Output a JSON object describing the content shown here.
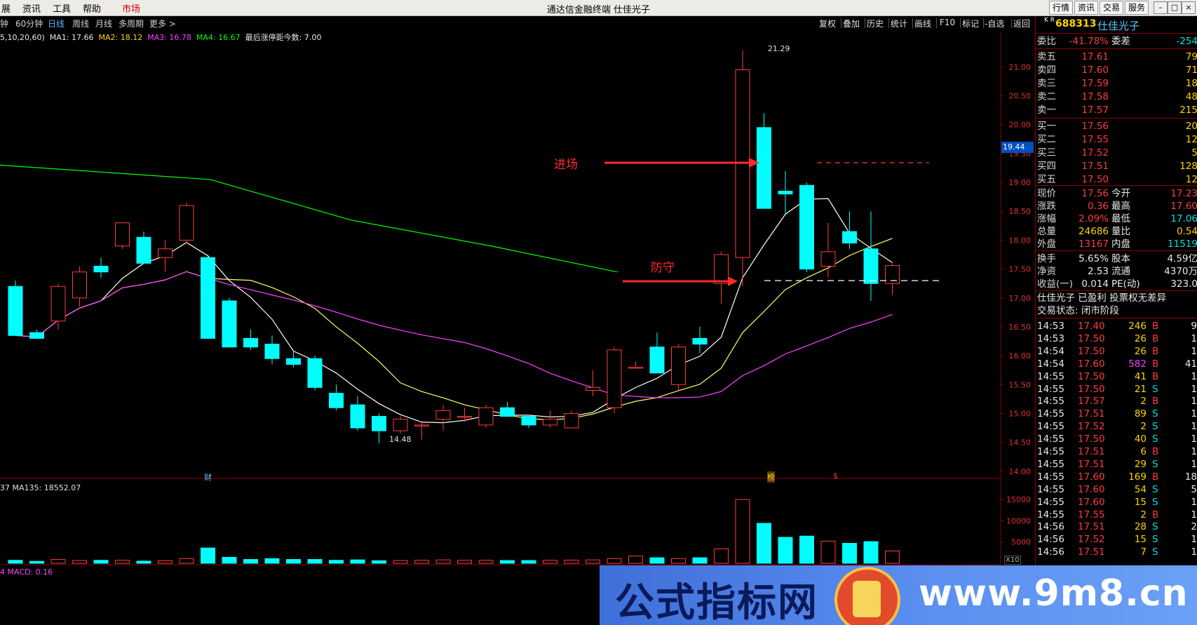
{
  "menu": {
    "items": [
      "展",
      "资讯",
      "工具",
      "帮助"
    ],
    "active": "市场"
  },
  "app_title": "通达信金融终端  仕佳光子",
  "top_right_buttons": [
    "行情",
    "资讯",
    "交易",
    "服务"
  ],
  "periods": [
    "钟",
    "60分钟",
    "日线",
    "周线",
    "月线",
    "多周期",
    "更多 >"
  ],
  "active_period": "日线",
  "toolbar": [
    "复权",
    "叠加",
    "历史",
    "统计",
    "画线",
    "F10",
    "标记",
    "-自选",
    "返回"
  ],
  "ma_line": {
    "prefix": "5,10,20,60)",
    "ma1": "MA1: 17.66",
    "ma2": "MA2: 18.12",
    "ma3": "MA3: 16.78",
    "ma4": "MA4: 16.67",
    "note": "最后涨停距今数: 7.00"
  },
  "y_axis_ticks": [
    "21.00",
    "20.50",
    "20.00",
    "19.50",
    "19.00",
    "18.50",
    "18.00",
    "17.50",
    "17.00",
    "16.50",
    "16.00",
    "15.50",
    "15.00",
    "14.50",
    "14.00"
  ],
  "cursor_price": "19.44",
  "high_label": "21.29",
  "low_label": "14.48",
  "annotations": {
    "entry": "进场",
    "defend": "防守"
  },
  "markers": {
    "cai": "财",
    "bang": "榜",
    "s": "$"
  },
  "volume_header": "37  MA135: 18552.07",
  "volume_ticks": [
    "15000",
    "10000",
    "5000"
  ],
  "volume_unit": "X10",
  "macd_header": "4  MACD: 0.16",
  "colors": {
    "up": "#ff3b3b",
    "down": "#00ffff",
    "ma1": "#ffffff",
    "ma2": "#ffff66",
    "ma3": "#ff44ff",
    "ma4": "#00ff00",
    "axis": "#8a0000"
  },
  "chart_data": {
    "type": "candlestick",
    "symbol": "688313",
    "name": "仕佳光子",
    "candles": [
      {
        "o": 17.2,
        "h": 17.3,
        "l": 16.35,
        "c": 16.35
      },
      {
        "o": 16.4,
        "h": 16.45,
        "l": 16.3,
        "c": 16.3
      },
      {
        "o": 16.6,
        "h": 17.25,
        "l": 16.45,
        "c": 17.2
      },
      {
        "o": 17.0,
        "h": 17.55,
        "l": 16.85,
        "c": 17.45
      },
      {
        "o": 17.55,
        "h": 17.7,
        "l": 17.35,
        "c": 17.45
      },
      {
        "o": 17.9,
        "h": 18.3,
        "l": 17.85,
        "c": 18.3
      },
      {
        "o": 18.05,
        "h": 18.15,
        "l": 17.6,
        "c": 17.6
      },
      {
        "o": 17.7,
        "h": 18.0,
        "l": 17.45,
        "c": 17.85
      },
      {
        "o": 18.0,
        "h": 18.65,
        "l": 17.95,
        "c": 18.6
      },
      {
        "o": 17.7,
        "h": 17.75,
        "l": 16.3,
        "c": 16.3
      },
      {
        "o": 16.95,
        "h": 17.0,
        "l": 16.15,
        "c": 16.15
      },
      {
        "o": 16.3,
        "h": 16.45,
        "l": 16.1,
        "c": 16.15
      },
      {
        "o": 16.2,
        "h": 16.35,
        "l": 15.85,
        "c": 15.95
      },
      {
        "o": 15.95,
        "h": 16.1,
        "l": 15.8,
        "c": 15.85
      },
      {
        "o": 15.95,
        "h": 16.0,
        "l": 15.4,
        "c": 15.45
      },
      {
        "o": 15.35,
        "h": 15.5,
        "l": 15.05,
        "c": 15.1
      },
      {
        "o": 15.15,
        "h": 15.3,
        "l": 14.7,
        "c": 14.75
      },
      {
        "o": 14.95,
        "h": 15.0,
        "l": 14.48,
        "c": 14.7
      },
      {
        "o": 14.7,
        "h": 14.95,
        "l": 14.65,
        "c": 14.9
      },
      {
        "o": 14.8,
        "h": 14.85,
        "l": 14.55,
        "c": 14.8
      },
      {
        "o": 14.9,
        "h": 15.15,
        "l": 14.7,
        "c": 15.05
      },
      {
        "o": 14.95,
        "h": 15.1,
        "l": 14.85,
        "c": 14.95
      },
      {
        "o": 14.8,
        "h": 15.15,
        "l": 14.75,
        "c": 15.1
      },
      {
        "o": 15.1,
        "h": 15.2,
        "l": 14.95,
        "c": 14.95
      },
      {
        "o": 14.95,
        "h": 14.95,
        "l": 14.75,
        "c": 14.8
      },
      {
        "o": 14.8,
        "h": 15.05,
        "l": 14.75,
        "c": 14.9
      },
      {
        "o": 14.75,
        "h": 15.05,
        "l": 14.75,
        "c": 15.0
      },
      {
        "o": 15.4,
        "h": 15.75,
        "l": 15.3,
        "c": 15.45
      },
      {
        "o": 15.1,
        "h": 16.15,
        "l": 15.0,
        "c": 16.1
      },
      {
        "o": 15.8,
        "h": 15.9,
        "l": 15.8,
        "c": 15.8
      },
      {
        "o": 16.15,
        "h": 16.4,
        "l": 15.7,
        "c": 15.7
      },
      {
        "o": 15.5,
        "h": 16.2,
        "l": 15.4,
        "c": 16.15
      },
      {
        "o": 16.3,
        "h": 16.5,
        "l": 16.05,
        "c": 16.2
      },
      {
        "o": 17.25,
        "h": 17.8,
        "l": 16.9,
        "c": 17.75
      },
      {
        "o": 17.7,
        "h": 21.29,
        "l": 17.2,
        "c": 20.95
      },
      {
        "o": 19.95,
        "h": 20.2,
        "l": 18.55,
        "c": 18.55
      },
      {
        "o": 18.85,
        "h": 19.2,
        "l": 18.45,
        "c": 18.8
      },
      {
        "o": 18.95,
        "h": 19.0,
        "l": 17.45,
        "c": 17.5
      },
      {
        "o": 17.55,
        "h": 18.3,
        "l": 17.35,
        "c": 17.8
      },
      {
        "o": 18.15,
        "h": 18.5,
        "l": 17.85,
        "c": 17.95
      },
      {
        "o": 17.85,
        "h": 18.5,
        "l": 16.95,
        "c": 17.25
      },
      {
        "o": 17.25,
        "h": 17.6,
        "l": 17.05,
        "c": 17.56
      }
    ],
    "ma_lines": {
      "MA1": 17.66,
      "MA2": 18.12,
      "MA3": 16.78,
      "MA4": 16.67
    },
    "volume": [
      700,
      450,
      900,
      650,
      700,
      700,
      500,
      600,
      1100,
      3600,
      1400,
      900,
      1100,
      900,
      900,
      700,
      800,
      600,
      650,
      700,
      800,
      700,
      700,
      650,
      650,
      700,
      750,
      800,
      1100,
      1700,
      1300,
      1100,
      1300,
      3400,
      15000,
      9400,
      6100,
      6400,
      5200,
      4700,
      5100,
      2900
    ],
    "ylim": [
      13.9,
      21.6
    ],
    "volume_ylim": [
      0,
      17000
    ]
  },
  "quote_panel": {
    "badge": "K R",
    "code": "688313",
    "name": "仕佳光子",
    "webi": {
      "label": "委比",
      "value": "-41.78%",
      "label2": "委差",
      "value2": "-254"
    },
    "asks": [
      {
        "label": "卖五",
        "price": "17.61",
        "vol": "79"
      },
      {
        "label": "卖四",
        "price": "17.60",
        "vol": "71"
      },
      {
        "label": "卖三",
        "price": "17.59",
        "vol": "18"
      },
      {
        "label": "卖二",
        "price": "17.58",
        "vol": "48"
      },
      {
        "label": "卖一",
        "price": "17.57",
        "vol": "215"
      }
    ],
    "bids": [
      {
        "label": "买一",
        "price": "17.56",
        "vol": "20"
      },
      {
        "label": "买二",
        "price": "17.55",
        "vol": "12"
      },
      {
        "label": "买三",
        "price": "17.52",
        "vol": "5"
      },
      {
        "label": "买四",
        "price": "17.51",
        "vol": "128"
      },
      {
        "label": "买五",
        "price": "17.50",
        "vol": "12"
      }
    ],
    "stats1": [
      {
        "l1": "现价",
        "v1": "17.56",
        "c1": "r",
        "l2": "今开",
        "v2": "17.23",
        "c2": "r"
      },
      {
        "l1": "涨跌",
        "v1": "0.36",
        "c1": "r",
        "l2": "最高",
        "v2": "17.60",
        "c2": "r"
      },
      {
        "l1": "涨幅",
        "v1": "2.09%",
        "c1": "r",
        "l2": "最低",
        "v2": "17.06",
        "c2": "g"
      },
      {
        "l1": "总量",
        "v1": "24686",
        "c1": "y",
        "l2": "量比",
        "v2": "0.54",
        "c2": "y"
      },
      {
        "l1": "外盘",
        "v1": "13167",
        "c1": "r",
        "l2": "内盘",
        "v2": "11519",
        "c2": "g"
      }
    ],
    "stats2": [
      {
        "l1": "换手",
        "v1": "5.65%",
        "l2": "股本",
        "v2": "4.59亿"
      },
      {
        "l1": "净资",
        "v1": "2.53",
        "l2": "流通",
        "v2": "4370万"
      },
      {
        "l1": "收益(一)",
        "v1": "0.014",
        "l2": "PE(动)",
        "v2": "323.0"
      }
    ],
    "info1": "仕佳光子 已盈利 投票权无差异",
    "info2": "交易状态: 闭市阶段",
    "ticks": [
      {
        "t": "14:53",
        "p": "17.40",
        "pc": "r",
        "v": "246",
        "vc": "y",
        "s": "B",
        "sc": "r",
        "n": "9"
      },
      {
        "t": "14:53",
        "p": "17.50",
        "pc": "r",
        "v": "26",
        "vc": "y",
        "s": "B",
        "sc": "r",
        "n": "1"
      },
      {
        "t": "14:54",
        "p": "17.50",
        "pc": "r",
        "v": "26",
        "vc": "y",
        "s": "B",
        "sc": "r",
        "n": "1"
      },
      {
        "t": "14:54",
        "p": "17.60",
        "pc": "r",
        "v": "582",
        "vc": "m",
        "s": "B",
        "sc": "r",
        "n": "41"
      },
      {
        "t": "14:55",
        "p": "17.50",
        "pc": "r",
        "v": "41",
        "vc": "y",
        "s": "B",
        "sc": "r",
        "n": "1"
      },
      {
        "t": "14:55",
        "p": "17.50",
        "pc": "r",
        "v": "21",
        "vc": "y",
        "s": "S",
        "sc": "g",
        "n": "1"
      },
      {
        "t": "14:55",
        "p": "17.57",
        "pc": "r",
        "v": "2",
        "vc": "y",
        "s": "B",
        "sc": "r",
        "n": "1"
      },
      {
        "t": "14:55",
        "p": "17.51",
        "pc": "r",
        "v": "89",
        "vc": "y",
        "s": "S",
        "sc": "g",
        "n": "1"
      },
      {
        "t": "14:55",
        "p": "17.52",
        "pc": "r",
        "v": "2",
        "vc": "y",
        "s": "S",
        "sc": "g",
        "n": "1"
      },
      {
        "t": "14:55",
        "p": "17.50",
        "pc": "r",
        "v": "40",
        "vc": "y",
        "s": "S",
        "sc": "g",
        "n": "1"
      },
      {
        "t": "14:55",
        "p": "17.51",
        "pc": "r",
        "v": "6",
        "vc": "y",
        "s": "B",
        "sc": "r",
        "n": "1"
      },
      {
        "t": "14:55",
        "p": "17.51",
        "pc": "r",
        "v": "29",
        "vc": "y",
        "s": "S",
        "sc": "g",
        "n": "1"
      },
      {
        "t": "14:55",
        "p": "17.60",
        "pc": "r",
        "v": "169",
        "vc": "y",
        "s": "B",
        "sc": "r",
        "n": "18"
      },
      {
        "t": "14:55",
        "p": "17.60",
        "pc": "r",
        "v": "54",
        "vc": "y",
        "s": "S",
        "sc": "g",
        "n": "5"
      },
      {
        "t": "14:55",
        "p": "17.60",
        "pc": "r",
        "v": "15",
        "vc": "y",
        "s": "S",
        "sc": "g",
        "n": "1"
      },
      {
        "t": "14:55",
        "p": "17.55",
        "pc": "r",
        "v": "2",
        "vc": "y",
        "s": "B",
        "sc": "r",
        "n": "1"
      },
      {
        "t": "14:56",
        "p": "17.51",
        "pc": "r",
        "v": "28",
        "vc": "y",
        "s": "S",
        "sc": "g",
        "n": "2"
      },
      {
        "t": "14:56",
        "p": "17.52",
        "pc": "r",
        "v": "15",
        "vc": "y",
        "s": "S",
        "sc": "g",
        "n": "1"
      },
      {
        "t": "14:56",
        "p": "17.51",
        "pc": "r",
        "v": "7",
        "vc": "y",
        "s": "S",
        "sc": "g",
        "n": "1"
      }
    ]
  },
  "banner": {
    "left": "公式指标网",
    "right": "www.9m8.cn"
  }
}
